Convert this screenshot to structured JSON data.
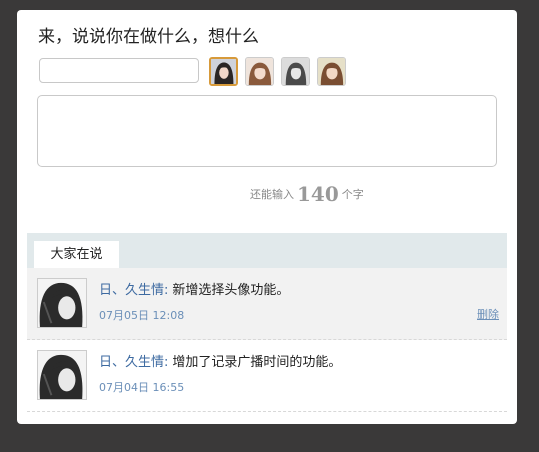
{
  "composer": {
    "title": "来，说说你在做什么，想什么",
    "name_value": "",
    "content_value": "",
    "counter_prefix": "还能输入",
    "counter_value": "140",
    "counter_suffix": "个字",
    "avatars": [
      {
        "name": "avatar-option-1",
        "selected": true
      },
      {
        "name": "avatar-option-2",
        "selected": false
      },
      {
        "name": "avatar-option-3",
        "selected": false
      },
      {
        "name": "avatar-option-4",
        "selected": false
      }
    ]
  },
  "feed": {
    "tab_label": "大家在说",
    "posts": [
      {
        "user": "日、久生情",
        "separator": ":",
        "message": "新增选择头像功能。",
        "time": "07月05日 12:08",
        "delete_label": "删除"
      },
      {
        "user": "日、久生情",
        "separator": ":",
        "message": "增加了记录广播时间的功能。",
        "time": "07月04日 16:55"
      }
    ]
  },
  "colors": {
    "background": "#3a3939",
    "tabbar": "#e1e9eb",
    "link": "#3d6aa1",
    "selected_avatar_border": "#d79a3a"
  }
}
